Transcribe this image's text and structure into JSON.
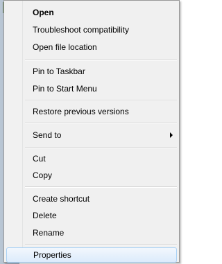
{
  "menu": {
    "open": "Open",
    "troubleshoot": "Troubleshoot compatibility",
    "open_location": "Open file location",
    "pin_taskbar": "Pin to Taskbar",
    "pin_start": "Pin to Start Menu",
    "restore": "Restore previous versions",
    "send_to": "Send to",
    "cut": "Cut",
    "copy": "Copy",
    "create_shortcut": "Create shortcut",
    "delete": "Delete",
    "rename": "Rename",
    "properties": "Properties"
  },
  "icons": {
    "submenu_arrow": "chevron-right-icon"
  },
  "colors": {
    "menu_bg": "#f0f0f0",
    "highlight_border": "#a8d1f5"
  }
}
